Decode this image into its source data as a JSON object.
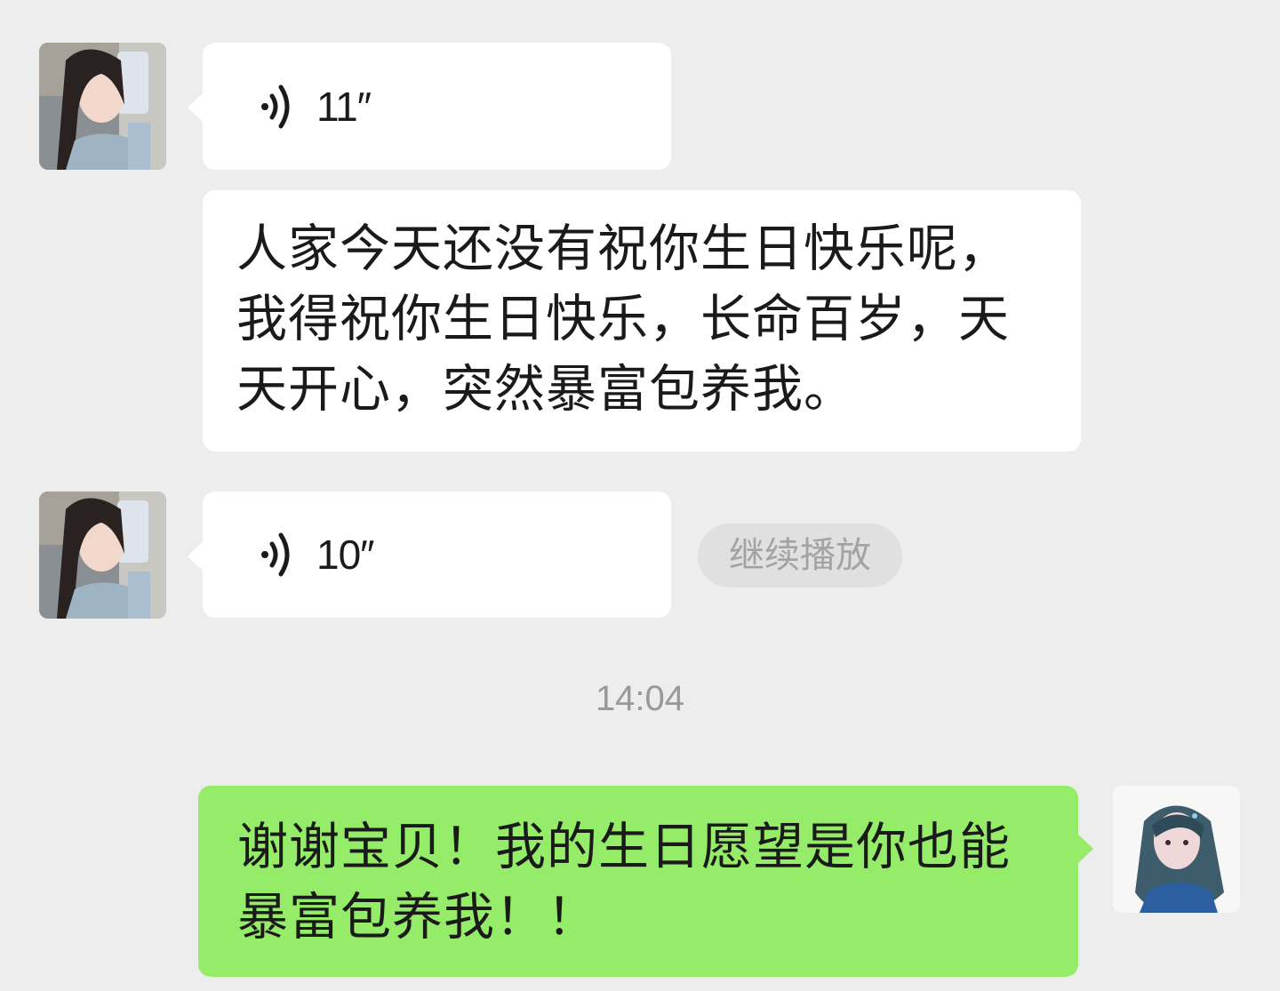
{
  "messages": [
    {
      "side": "left",
      "type": "voice",
      "duration": "11″"
    },
    {
      "side": "left",
      "type": "text",
      "text": "人家今天还没有祝你生日快乐呢，\n我得祝你生日快乐，长命百岁，天\n天开心，突然暴富包养我。"
    },
    {
      "side": "left",
      "type": "voice",
      "duration": "10″",
      "action_label": "继续播放"
    },
    {
      "side": "right",
      "type": "text",
      "text": "谢谢宝贝！我的生日愿望是你也能\n暴富包养我！！"
    }
  ],
  "timestamp": "14:04",
  "colors": {
    "background": "#ededed",
    "received_bubble": "#ffffff",
    "sent_bubble": "#95ec69",
    "timestamp_text": "#999999",
    "continue_button_bg": "#e0e0e0"
  },
  "icons": {
    "voice": "voice-wave-icon"
  }
}
